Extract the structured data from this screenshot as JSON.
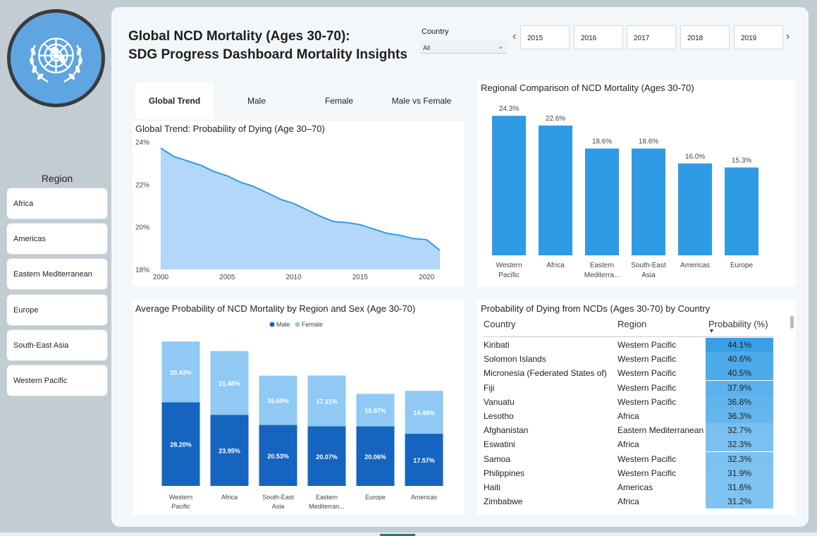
{
  "header": {
    "title_line1": "Global NCD Mortality (Ages 30-70):",
    "title_line2": "SDG Progress Dashboard Mortality Insights",
    "country_label": "Country",
    "country_value": "All",
    "years": [
      "2015",
      "2016",
      "2017",
      "2018",
      "2019"
    ]
  },
  "sidebar": {
    "logo_icon": "un-emblem-icon",
    "region_title": "Region",
    "regions": [
      "Africa",
      "Americas",
      "Eastern Mediterranean",
      "Europe",
      "South-East Asia",
      "Western Pacific"
    ]
  },
  "tabs": [
    "Global Trend",
    "Male",
    "Female",
    "Male vs Female"
  ],
  "colors": {
    "accent": "#2f9be5",
    "area_fill": "#b2d7f8",
    "male": "#1565c0",
    "female": "#90c9f4",
    "bar": "#2f9be5"
  },
  "chart_data": [
    {
      "type": "area",
      "title": "Global Trend: Probability of Dying (Age 30–70)",
      "x": [
        2000,
        2001,
        2002,
        2003,
        2004,
        2005,
        2006,
        2007,
        2008,
        2009,
        2010,
        2011,
        2012,
        2013,
        2014,
        2015,
        2016,
        2017,
        2018,
        2019,
        2020,
        2021
      ],
      "y": [
        23.7,
        23.3,
        23.1,
        22.9,
        22.6,
        22.4,
        22.1,
        21.9,
        21.6,
        21.3,
        21.1,
        20.8,
        20.5,
        20.25,
        20.2,
        20.1,
        19.9,
        19.7,
        19.6,
        19.45,
        19.4,
        18.9
      ],
      "ylim": [
        18,
        24
      ],
      "yticks": [
        "24%",
        "22%",
        "20%",
        "18%"
      ],
      "xticks": [
        "2000",
        "2005",
        "2010",
        "2015",
        "2020"
      ]
    },
    {
      "type": "bar",
      "title": "Regional Comparison of NCD Mortality (Ages 30-70)",
      "categories": [
        "Western Pacific",
        "Africa",
        "Eastern Mediterra...",
        "South-East Asia",
        "Americas",
        "Europe"
      ],
      "values": [
        24.3,
        22.6,
        18.6,
        18.6,
        16.0,
        15.3
      ],
      "labels": [
        "24.3%",
        "22.6%",
        "18.6%",
        "18.6%",
        "16.0%",
        "15.3%"
      ]
    },
    {
      "type": "bar",
      "stacked": true,
      "title": "Average Probability of NCD Mortality by Region and Sex (Age 30-70)",
      "legend_position": "top-center",
      "categories": [
        "Western Pacific",
        "Africa",
        "South-East Asia",
        "Eastern Mediterran...",
        "Europe",
        "Americas"
      ],
      "series": [
        {
          "name": "Male",
          "values": [
            28.2,
            23.95,
            20.53,
            20.07,
            20.06,
            17.57
          ],
          "labels": [
            "28.20%",
            "23.95%",
            "20.53%",
            "20.07%",
            "20.06%",
            "17.57%"
          ]
        },
        {
          "name": "Female",
          "values": [
            20.43,
            21.48,
            16.6,
            17.11,
            10.97,
            14.46
          ],
          "labels": [
            "20.43%",
            "21.48%",
            "16.60%",
            "17.11%",
            "10.97%",
            "14.46%"
          ]
        }
      ]
    },
    {
      "type": "table",
      "title": "Probability of Dying from NCDs (Ages 30-70) by Country",
      "columns": [
        "Country",
        "Region",
        "Probability (%)"
      ],
      "sort_icon": "sort-down-icon",
      "rows": [
        [
          "Kiribati",
          "Western Pacific",
          "44.1%"
        ],
        [
          "Solomon Islands",
          "Western Pacific",
          "40.6%"
        ],
        [
          "Micronesia (Federated States of)",
          "Western Pacific",
          "40.5%"
        ],
        [
          "Fiji",
          "Western Pacific",
          "37.9%"
        ],
        [
          "Vanuatu",
          "Western Pacific",
          "36.8%"
        ],
        [
          "Lesotho",
          "Africa",
          "36.3%"
        ],
        [
          "Afghanistan",
          "Eastern Mediterranean",
          "32.7%"
        ],
        [
          "Eswatini",
          "Africa",
          "32.3%"
        ],
        [
          "Samoa",
          "Western Pacific",
          "32.3%"
        ],
        [
          "Philippines",
          "Western Pacific",
          "31.9%"
        ],
        [
          "Haiti",
          "Americas",
          "31.6%"
        ],
        [
          "Zimbabwe",
          "Africa",
          "31.2%"
        ]
      ],
      "values": [
        44.1,
        40.6,
        40.5,
        37.9,
        36.8,
        36.3,
        32.7,
        32.3,
        32.3,
        31.9,
        31.6,
        31.2
      ]
    }
  ]
}
